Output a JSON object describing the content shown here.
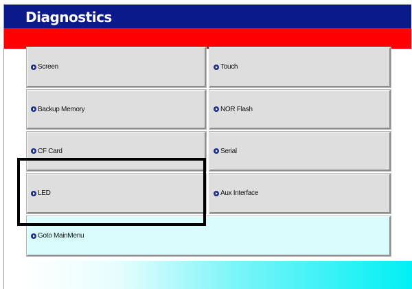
{
  "title": "Diagnostics",
  "menu": {
    "screen": "Screen",
    "touch": "Touch",
    "backup_memory": "Backup Memory",
    "nor_flash": "NOR Flash",
    "cf_card": "CF Card",
    "serial": "Serial",
    "led": "LED",
    "aux_interface": "Aux Interface",
    "goto_mainmenu": "Goto MainMenu"
  },
  "icon": "arrow-right-circle-icon",
  "colors": {
    "title_bar": "#0b1a8a",
    "red_band": "#ff0000",
    "button_face": "#dedede",
    "wide_button_face": "#d9fdfd",
    "cyan_band": "#00f0f5",
    "highlight": "#000000"
  }
}
